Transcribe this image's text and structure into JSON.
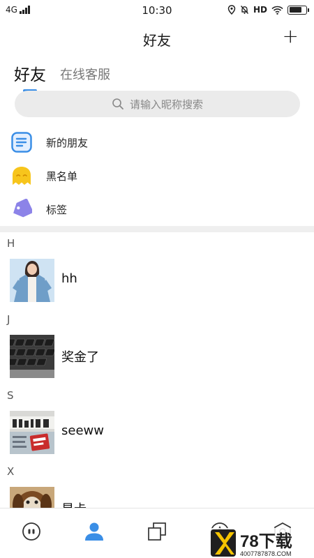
{
  "status_bar": {
    "network": "4G",
    "time": "10:30",
    "hd": "HD",
    "battery_level": 0.75
  },
  "header": {
    "title": "好友",
    "add_label": "+"
  },
  "tabs": [
    {
      "label": "好友",
      "active": true
    },
    {
      "label": "在线客服",
      "active": false
    }
  ],
  "search": {
    "placeholder": "请输入昵称搜索"
  },
  "menu": [
    {
      "label": "新的朋友",
      "icon": "new-friends-icon"
    },
    {
      "label": "黑名单",
      "icon": "blacklist-icon"
    },
    {
      "label": "标签",
      "icon": "tag-icon"
    }
  ],
  "contacts": [
    {
      "letter": "H",
      "name": "hh",
      "avatar": "avatar-girl-denim-photo"
    },
    {
      "letter": "J",
      "name": "奖金了",
      "avatar": "avatar-keyboard-photo"
    },
    {
      "letter": "S",
      "name": "seeww",
      "avatar": "avatar-newspaper-photo"
    },
    {
      "letter": "X",
      "name": "星卡",
      "avatar": "avatar-dog-photo"
    }
  ],
  "bottom_nav": [
    {
      "icon": "chat-icon",
      "active": false
    },
    {
      "icon": "friends-icon",
      "active": true
    },
    {
      "icon": "square-stack-icon",
      "active": false
    },
    {
      "icon": "discover-icon",
      "active": false
    },
    {
      "icon": "profile-hex-icon",
      "active": false
    }
  ],
  "watermark": {
    "brand": "78下载",
    "url": "4007787878.COM"
  },
  "colors": {
    "accent": "#3a8ee6",
    "search_bg": "#ebebeb",
    "divider": "#efefef",
    "blacklist_yellow": "#f7c51c",
    "tag_purple": "#8c83e8"
  }
}
